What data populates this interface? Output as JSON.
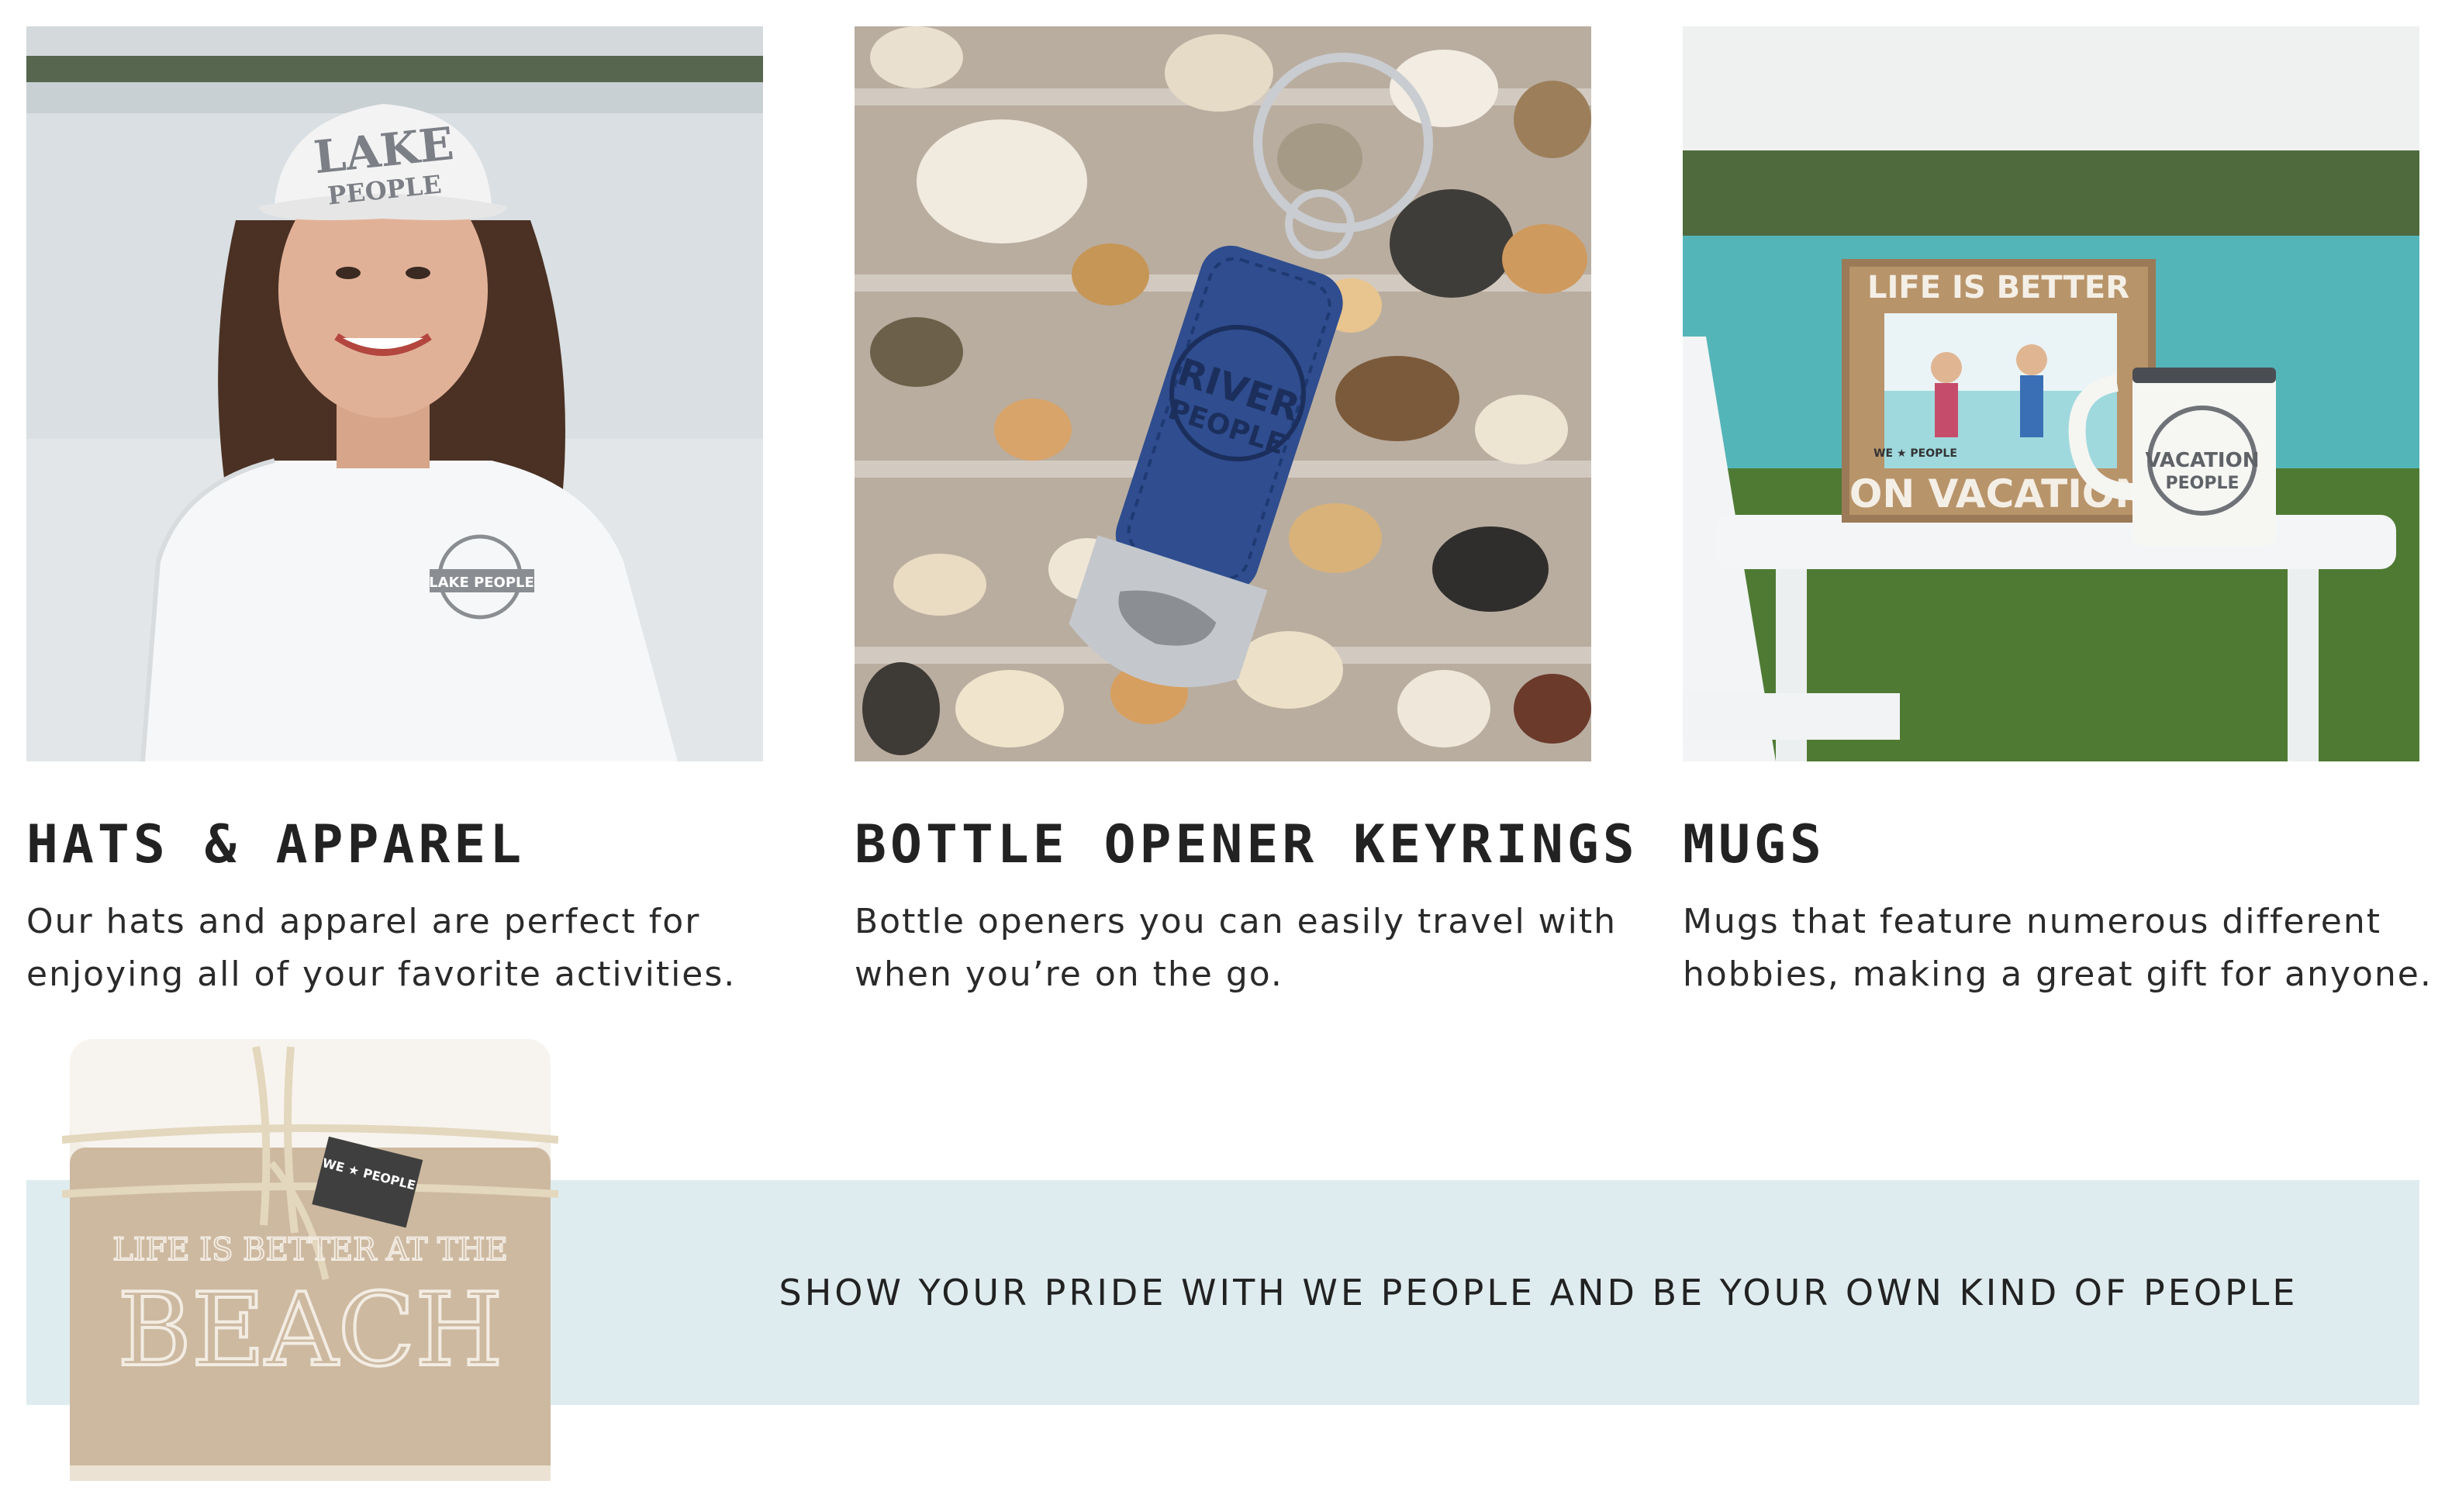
{
  "cards": [
    {
      "title": "HATS & APPAREL",
      "description": "Our hats and apparel are perfect for enjoying all of your favorite activities.",
      "hat_text_line1": "LAKE",
      "hat_text_line2": "PEOPLE",
      "shirt_logo_text": "LAKE PEOPLE"
    },
    {
      "title": "BOTTLE OPENER KEYRINGS",
      "description": "Bottle openers you can easily travel with when you’re on the go.",
      "keyring_text_line1": "RIVER",
      "keyring_text_line2": "PEOPLE"
    },
    {
      "title": "MUGS",
      "description": "Mugs that feature numerous different hobbies, making a great gift for anyone.",
      "frame_top_text": "LIFE IS BETTER",
      "frame_bottom_text": "ON VACATION",
      "frame_brand_text": "WE ★ PEOPLE",
      "mug_text_line1": "VACATION",
      "mug_text_line2": "PEOPLE"
    }
  ],
  "banner": {
    "text": "SHOW YOUR PRIDE WITH WE PEOPLE AND BE YOUR OWN KIND OF PEOPLE",
    "background_color": "#dfecef",
    "blanket_text_line1": "LIFE IS BETTER AT THE",
    "blanket_text_line2": "BEACH",
    "tag_text": "WE ★ PEOPLE"
  }
}
